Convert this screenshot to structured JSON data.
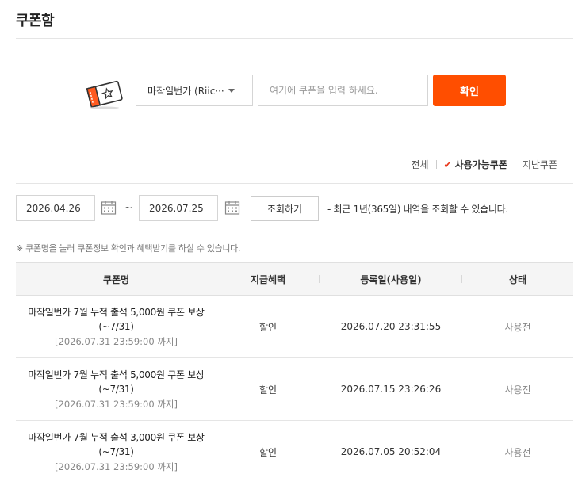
{
  "page": {
    "title": "쿠폰함"
  },
  "register": {
    "game_select": "마작일번가 (Riic···",
    "coupon_placeholder": "여기에 쿠폰을 입력 하세요.",
    "confirm_label": "확인"
  },
  "filters": {
    "all": "전체",
    "available": "사용가능쿠폰",
    "expired": "지난쿠폰"
  },
  "date_search": {
    "start_date": "2026.04.26",
    "separator": "~",
    "end_date": "2026.07.25",
    "search_label": "조회하기",
    "range_note": "- 최근 1년(365일) 내역을 조회할 수 있습니다."
  },
  "notice": "※ 쿠폰명을 눌러 쿠폰정보 확인과 혜택받기를 하실 수 있습니다.",
  "table": {
    "headers": [
      "쿠폰명",
      "지급혜택",
      "등록일(사용일)",
      "상태"
    ],
    "rows": [
      {
        "name": "마작일번가 7월 누적 출석 5,000원 쿠폰 보상 (~7/31)",
        "expiry": "[2026.07.31 23:59:00 까지]",
        "benefit": "할인",
        "date": "2026.07.20 23:31:55",
        "status": "사용전"
      },
      {
        "name": "마작일번가 7월 누적 출석 5,000원 쿠폰 보상 (~7/31)",
        "expiry": "[2026.07.31 23:59:00 까지]",
        "benefit": "할인",
        "date": "2026.07.15 23:26:26",
        "status": "사용전"
      },
      {
        "name": "마작일번가 7월 누적 출석 3,000원 쿠폰 보상 (~7/31)",
        "expiry": "[2026.07.31 23:59:00 까지]",
        "benefit": "할인",
        "date": "2026.07.05 20:52:04",
        "status": "사용전"
      }
    ]
  },
  "colors": {
    "accent": "#ff4e00",
    "check": "#e8371b"
  },
  "icons": {
    "coupon": "coupon-ticket-icon",
    "calendar": "calendar-icon",
    "check": "check-icon",
    "caret": "chevron-down-icon"
  }
}
